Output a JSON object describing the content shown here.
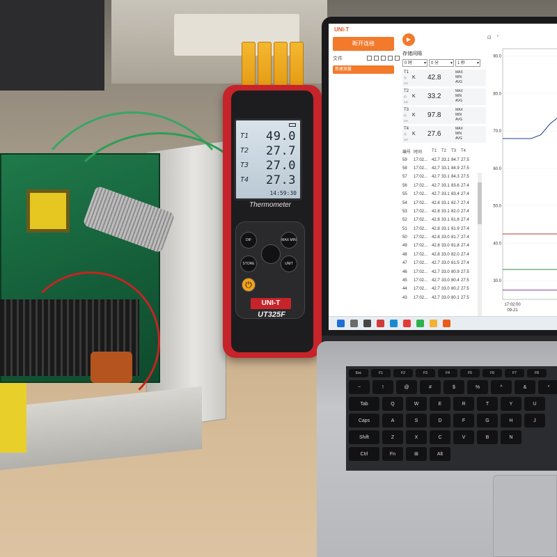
{
  "meter": {
    "display": [
      {
        "label": "T1",
        "value": "49.0"
      },
      {
        "label": "T2",
        "value": "27.7"
      },
      {
        "label": "T3",
        "value": "27.0"
      },
      {
        "label": "T4",
        "value": "27.3"
      }
    ],
    "time": "14:59:30",
    "name": "Thermometer",
    "brand": "UNI-T",
    "model": "UT325F",
    "keys": {
      "dif": "DIF",
      "max_min": "MAX MIN",
      "store": "STORE",
      "unit": "UNIT"
    }
  },
  "app": {
    "brand": "UNI-T",
    "connect_label": "断开连接",
    "file_menu": "文件",
    "tree_item": "新建测量",
    "interval_label": "存储间隔",
    "interval": {
      "hour": "0 时",
      "minute": "0 分",
      "second": "1 秒"
    },
    "channels": [
      {
        "name": "T1",
        "unit": "K",
        "value": "42.8"
      },
      {
        "name": "T2",
        "unit": "K",
        "value": "33.2"
      },
      {
        "name": "T3",
        "unit": "K",
        "value": "97.8"
      },
      {
        "name": "T4",
        "unit": "K",
        "value": "27.6"
      }
    ],
    "stat_labels": [
      "MAX",
      "MIN",
      "AVG"
    ],
    "dif_label": "DIF",
    "table": {
      "headers": [
        "编号",
        "时间",
        "T1",
        "T2",
        "T3",
        "T4"
      ],
      "rows": [
        [
          "59",
          "17:02...",
          "42.7",
          "33.1",
          "84.7",
          "27.5"
        ],
        [
          "58",
          "17:02...",
          "42.7",
          "33.1",
          "84.9",
          "27.5"
        ],
        [
          "57",
          "17:02...",
          "42.7",
          "33.1",
          "84.3",
          "27.5"
        ],
        [
          "56",
          "17:02...",
          "42.7",
          "33.1",
          "83.6",
          "27.4"
        ],
        [
          "55",
          "17:02...",
          "42.7",
          "33.1",
          "83.4",
          "27.4"
        ],
        [
          "54",
          "17:02...",
          "42.8",
          "33.1",
          "82.7",
          "27.4"
        ],
        [
          "53",
          "17:02...",
          "42.8",
          "33.1",
          "82.0",
          "27.4"
        ],
        [
          "52",
          "17:02...",
          "42.8",
          "33.1",
          "81.8",
          "27.4"
        ],
        [
          "51",
          "17:02...",
          "42.8",
          "33.1",
          "81.9",
          "27.4"
        ],
        [
          "50",
          "17:02...",
          "42.8",
          "33.0",
          "81.7",
          "27.4"
        ],
        [
          "49",
          "17:02...",
          "42.8",
          "33.0",
          "81.8",
          "27.4"
        ],
        [
          "48",
          "17:02...",
          "42.8",
          "33.0",
          "82.0",
          "27.4"
        ],
        [
          "47",
          "17:02...",
          "42.7",
          "33.0",
          "81.5",
          "27.4"
        ],
        [
          "46",
          "17:02...",
          "42.7",
          "33.0",
          "80.9",
          "27.5"
        ],
        [
          "45",
          "17:02...",
          "42.7",
          "33.0",
          "80.4",
          "27.5"
        ],
        [
          "44",
          "17:02...",
          "42.7",
          "33.0",
          "80.2",
          "27.5"
        ],
        [
          "43",
          "17:02...",
          "42.7",
          "33.0",
          "80.1",
          "27.5"
        ]
      ]
    }
  },
  "chart_data": {
    "type": "line",
    "title": "",
    "xlabel": "",
    "ylabel": "",
    "ylim": [
      25,
      92
    ],
    "y_ticks": [
      "90.0",
      "80.0",
      "70.0",
      "60.0",
      "50.0",
      "40.0",
      "30.0"
    ],
    "x_ticks": [
      "17:02:00"
    ],
    "x_date": "09-21",
    "series": [
      {
        "color": "#1f3c88",
        "values": [
          68,
          68,
          68,
          68,
          69,
          72,
          74
        ]
      },
      {
        "color": "#b23a3a",
        "values": [
          42.5,
          42.5,
          42.5,
          42.5,
          42.5,
          42.5,
          42.5
        ]
      },
      {
        "color": "#2e8b3e",
        "values": [
          33,
          33,
          33,
          33,
          33,
          33,
          33
        ]
      },
      {
        "color": "#8e3f9c",
        "values": [
          27.5,
          27.5,
          27.5,
          27.5,
          27.5,
          27.5,
          27.5
        ]
      }
    ]
  },
  "keyboard": {
    "fn_row": [
      "Esc",
      "F1",
      "F2",
      "F3",
      "F4",
      "F5",
      "F6",
      "F7",
      "F8"
    ],
    "num_row": [
      "~",
      "!",
      "@",
      "#",
      "$",
      "%",
      "^",
      "&",
      "*"
    ],
    "row_q": [
      "Tab",
      "Q",
      "W",
      "E",
      "R",
      "T",
      "Y",
      "U"
    ],
    "row_a": [
      "Caps",
      "A",
      "S",
      "D",
      "F",
      "G",
      "H",
      "J"
    ],
    "row_z": [
      "Shift",
      "Z",
      "X",
      "C",
      "V",
      "B",
      "N"
    ],
    "row_bottom": [
      "Ctrl",
      "Fn",
      "⊞",
      "Alt"
    ]
  }
}
